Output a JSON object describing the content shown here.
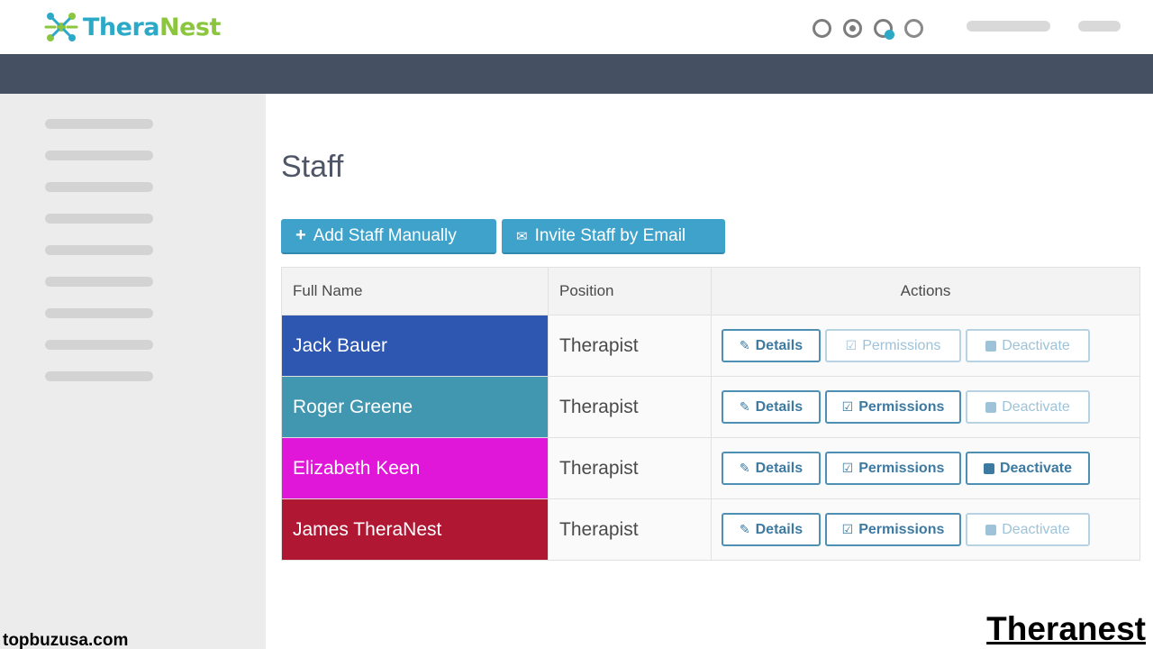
{
  "brand": {
    "logo_thera": "Thera",
    "logo_nest": "Nest",
    "colors": {
      "thera": "#2ba9c6",
      "nest": "#8cc63f"
    }
  },
  "header": {
    "icons": [
      "user-circle-icon",
      "settings-circle-icon",
      "search-icon",
      "help-circle-icon"
    ]
  },
  "colors": {
    "navbar": "#465063",
    "sidebar": "#ececec",
    "primary_button": "#3fa2cb",
    "action_border": "#4e8fb3"
  },
  "main": {
    "page_title": "Staff",
    "add_button": "Add Staff Manually",
    "invite_button": "Invite Staff by Email"
  },
  "table": {
    "headers": [
      "Full Name",
      "Position",
      "Actions"
    ],
    "actions": [
      "Details",
      "Permissions",
      "Deactivate"
    ],
    "rows": [
      {
        "name": "Jack Bauer",
        "position": "Therapist",
        "color": "#2d57b0",
        "permissions_enabled": false,
        "deactivate_enabled": false
      },
      {
        "name": "Roger Greene",
        "position": "Therapist",
        "color": "#4196b0",
        "permissions_enabled": true,
        "deactivate_enabled": false
      },
      {
        "name": "Elizabeth Keen",
        "position": "Therapist",
        "color": "#e016d8",
        "permissions_enabled": true,
        "deactivate_enabled": true
      },
      {
        "name": "James TheraNest",
        "position": "Therapist",
        "color": "#b01733",
        "permissions_enabled": true,
        "deactivate_enabled": false
      }
    ]
  },
  "watermark": {
    "left": "topbuzusa.com",
    "right": "Theranest"
  }
}
